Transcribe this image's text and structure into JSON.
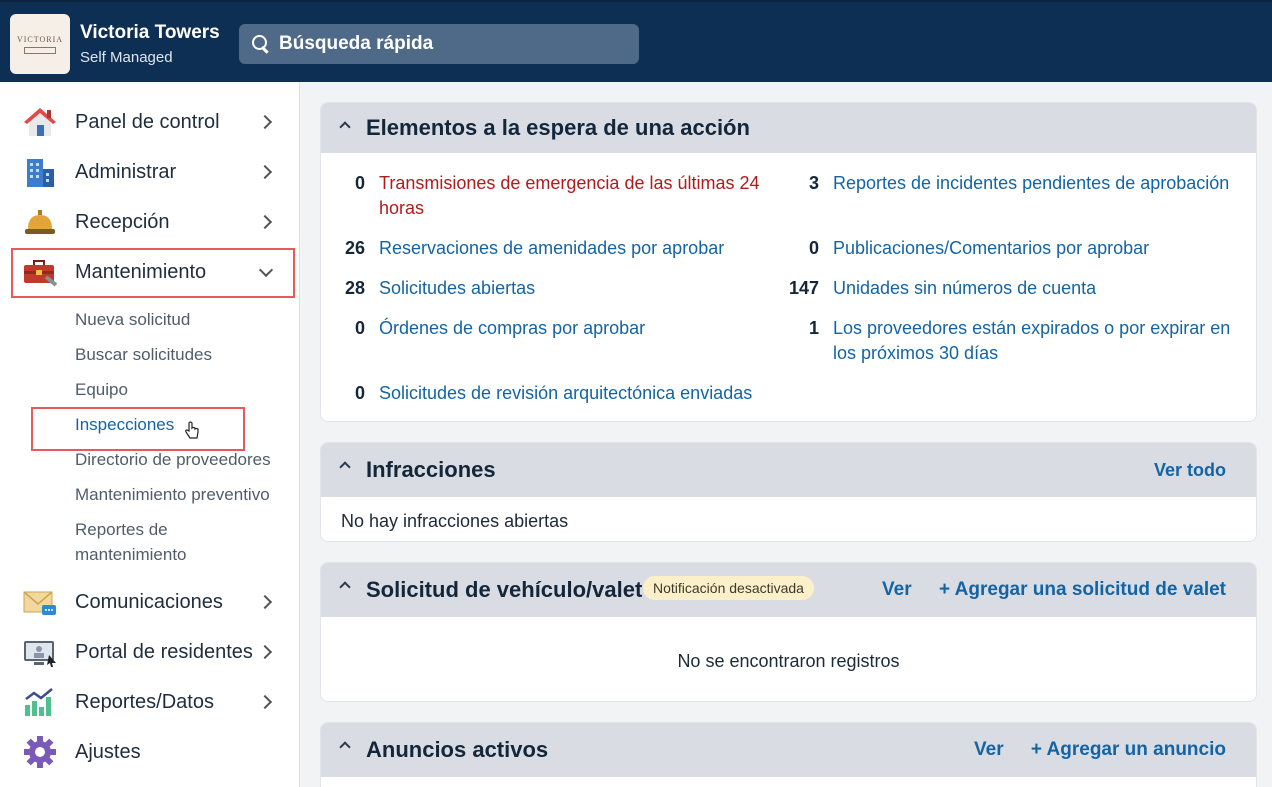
{
  "header": {
    "logo_text": "VICTORIA",
    "property_name": "Victoria Towers",
    "property_type": "Self Managed",
    "search_placeholder": "Búsqueda rápida"
  },
  "sidebar": {
    "items": [
      {
        "label": "Panel de control",
        "icon": "home-icon"
      },
      {
        "label": "Administrar",
        "icon": "building-icon"
      },
      {
        "label": "Recepción",
        "icon": "bell-icon"
      },
      {
        "label": "Mantenimiento",
        "icon": "toolbox-icon"
      },
      {
        "label": "Comunicaciones",
        "icon": "envelope-icon"
      },
      {
        "label": "Portal de residentes",
        "icon": "monitor-icon"
      },
      {
        "label": "Reportes/Datos",
        "icon": "chart-icon"
      },
      {
        "label": "Ajustes",
        "icon": "gear-icon"
      }
    ],
    "maintenance_sub": [
      "Nueva solicitud",
      "Buscar solicitudes",
      "Equipo",
      "Inspecciones",
      "Directorio de proveedores",
      "Mantenimiento preventivo",
      "Reportes de",
      "mantenimiento"
    ]
  },
  "pending": {
    "title": "Elementos a la espera de una acción",
    "left": [
      {
        "count": "0",
        "line1": "Transmisiones de emergencia de las últimas 24",
        "line2": "horas"
      },
      {
        "count": "26",
        "line1": "Reservaciones de amenidades por aprobar"
      },
      {
        "count": "28",
        "line1": "Solicitudes abiertas"
      },
      {
        "count": "0",
        "line1": "Órdenes de compras por aprobar"
      },
      {
        "count": "0",
        "line1": "Solicitudes de revisión arquitectónica enviadas"
      }
    ],
    "right": [
      {
        "count": "3",
        "line1": "Reportes de incidentes pendientes de aprobación"
      },
      {
        "count": "0",
        "line1": "Publicaciones/Comentarios por aprobar"
      },
      {
        "count": "147",
        "line1": "Unidades sin números de cuenta"
      },
      {
        "count": "1",
        "line1": "Los proveedores están expirados o por expirar en",
        "line2": "los próximos 30 días"
      }
    ]
  },
  "violations": {
    "title": "Infracciones",
    "view_all": "Ver todo",
    "empty": "No hay infracciones abiertas"
  },
  "valet": {
    "title": "Solicitud de vehículo/valet",
    "badge": "Notificación desactivada",
    "view": "Ver",
    "add": "+ Agregar una solicitud de valet",
    "empty": "No se encontraron registros"
  },
  "announcements": {
    "title": "Anuncios activos",
    "view": "Ver",
    "add": "+ Agregar un anuncio"
  },
  "colors": {
    "header_bg": "#0d2f54",
    "link": "#1464a5",
    "alert": "#b01b1b",
    "highlight_box": "#e85a5a"
  }
}
